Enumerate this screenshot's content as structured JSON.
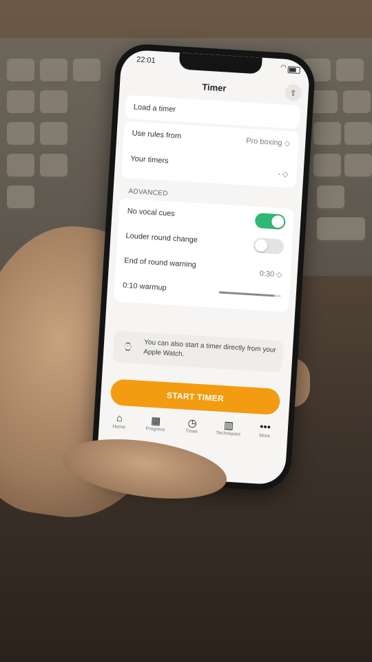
{
  "status": {
    "time": "22:01"
  },
  "nav": {
    "title": "Timer"
  },
  "rows": {
    "load_timer": "Load a timer",
    "use_rules_label": "Use rules from",
    "use_rules_value": "Pro boxing ◇",
    "your_timers_label": "Your timers",
    "your_timers_value": "- ◇"
  },
  "advanced": {
    "section_label": "ADVANCED",
    "no_vocal_cues": "No vocal cues",
    "no_vocal_cues_on": true,
    "louder_round_change": "Louder round change",
    "louder_round_change_on": false,
    "end_warning_label": "End of round warning",
    "end_warning_value": "0:30 ◇",
    "warmup_label": "0:10 warmup",
    "warmup_level": 0.9
  },
  "watch_note": "You can also start a timer directly from your Apple Watch.",
  "start_button": "START TIMER",
  "tabs": [
    {
      "label": "Home",
      "icon": "home-icon"
    },
    {
      "label": "Progress",
      "icon": "calendar-icon"
    },
    {
      "label": "Timer",
      "icon": "stopwatch-icon"
    },
    {
      "label": "Techniques",
      "icon": "book-icon"
    },
    {
      "label": "More",
      "icon": "ellipsis-icon"
    }
  ],
  "colors": {
    "accent": "#f39c12",
    "toggle_on": "#2fb873"
  }
}
